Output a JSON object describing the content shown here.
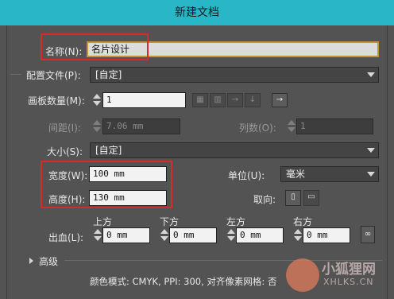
{
  "window": {
    "title": "新建文档"
  },
  "name": {
    "label": "名称(N):",
    "value": "名片设计"
  },
  "profile": {
    "label": "配置文件(P):",
    "value": "[自定]"
  },
  "artboards": {
    "count_label": "画板数量(M):",
    "count_value": "1",
    "spacing_label": "间距(I):",
    "spacing_value": "7.06 mm",
    "columns_label": "列数(O):",
    "columns_value": "1",
    "arrange_icons": [
      "grid-by-row-icon",
      "grid-by-column-icon",
      "arrange-by-row-icon",
      "arrange-by-column-icon",
      "right-to-left-icon"
    ]
  },
  "size": {
    "label": "大小(S):",
    "value": "[自定]"
  },
  "width": {
    "label": "宽度(W):",
    "value": "100 mm"
  },
  "height": {
    "label": "高度(H):",
    "value": "130 mm"
  },
  "units": {
    "label": "单位(U):",
    "value": "毫米"
  },
  "orientation": {
    "label": "取向:",
    "icons": [
      "portrait-icon",
      "landscape-icon"
    ]
  },
  "bleed": {
    "label": "出血(L):",
    "top_label": "上方",
    "top_value": "0 mm",
    "bottom_label": "下方",
    "bottom_value": "0 mm",
    "left_label": "左方",
    "left_value": "0 mm",
    "right_label": "右方",
    "right_value": "0 mm"
  },
  "advanced": {
    "label": "高级"
  },
  "footer": {
    "color_mode": "颜色模式: CMYK, PPI: 300, 对齐像素网格: 否"
  },
  "watermark": {
    "text_cn": "小狐狸网",
    "text_en": "XHLKS.CN"
  },
  "colors": {
    "title_bar": "#29b7c8",
    "dialog_bg": "#535353",
    "highlight": "#d42b2b",
    "focus_border": "#c49332"
  }
}
